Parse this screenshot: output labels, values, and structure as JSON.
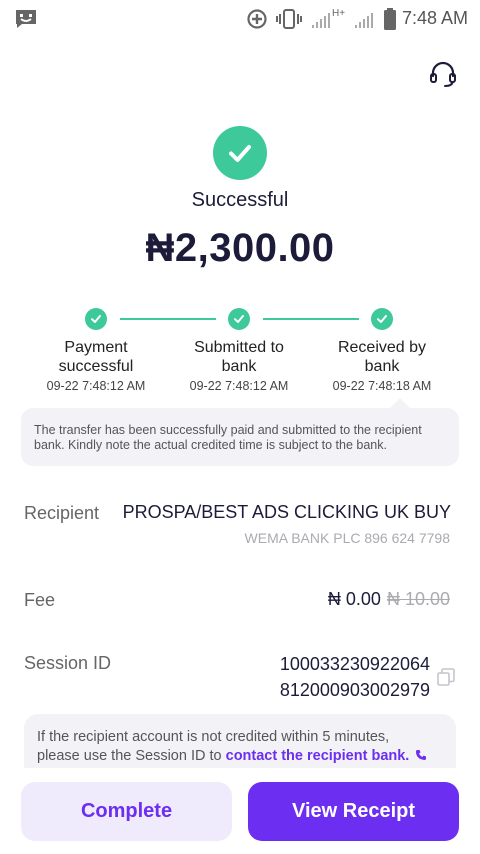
{
  "status_bar": {
    "time": "7:48 AM",
    "network": "H+"
  },
  "transaction": {
    "status": "Successful",
    "amount": "₦2,300.00"
  },
  "steps": [
    {
      "label_line1": "Payment",
      "label_line2": "successful",
      "time": "09-22 7:48:12 AM"
    },
    {
      "label_line1": "Submitted to",
      "label_line2": "bank",
      "time": "09-22 7:48:12 AM"
    },
    {
      "label_line1": "Received by",
      "label_line2": "bank",
      "time": "09-22 7:48:18 AM"
    }
  ],
  "note": {
    "line1": "The transfer has been successfully paid and submitted to the recipient",
    "line2": "bank. Kindly note the actual credited time is subject to the bank."
  },
  "details": {
    "recipient_label": "Recipient",
    "recipient_name": "PROSPA/BEST ADS CLICKING UK BUY",
    "recipient_bank": "WEMA BANK PLC 896 624 7798",
    "fee_label": "Fee",
    "fee_now": "₦ 0.00",
    "fee_old": "₦ 10.00",
    "session_label": "Session ID",
    "session_line1": "100033230922064",
    "session_line2": "812000903002979"
  },
  "info": {
    "line1": "If the recipient account is not credited within 5 minutes,",
    "line2_prefix": "please use the Session ID to ",
    "link": "contact the recipient bank."
  },
  "buttons": {
    "complete": "Complete",
    "view_receipt": "View Receipt"
  },
  "colors": {
    "accent": "#6c2ef0",
    "success": "#3ec99a",
    "accent_light": "#efebfd"
  },
  "icons": [
    "message-icon",
    "add-circle-icon",
    "vibrate-icon",
    "signal-icon",
    "battery-icon",
    "headset-icon",
    "check-icon",
    "copy-icon",
    "phone-icon"
  ]
}
